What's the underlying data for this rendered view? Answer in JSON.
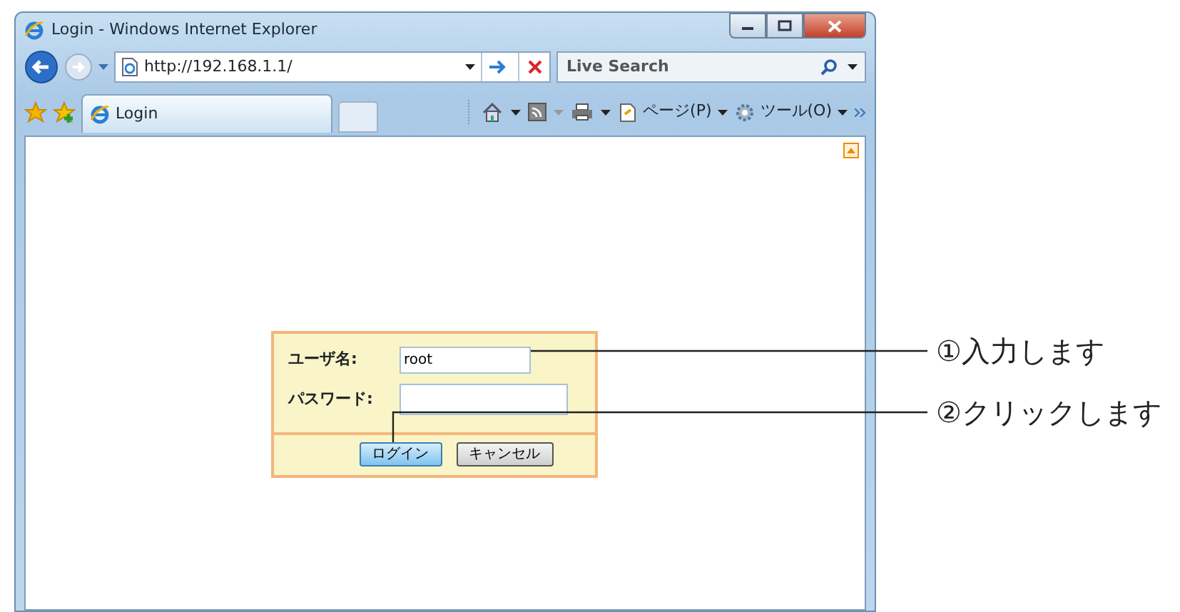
{
  "window": {
    "title": "Login - Windows Internet Explorer"
  },
  "address_bar": {
    "url": "http://192.168.1.1/"
  },
  "search": {
    "placeholder": "Live Search"
  },
  "tabs": [
    {
      "label": "Login",
      "selected": true
    }
  ],
  "toolbar": [
    {
      "label": "ページ(P)"
    },
    {
      "label": "ツール(O)"
    }
  ],
  "form": {
    "fields": [
      {
        "label": "ユーザ名:",
        "value": "root"
      },
      {
        "label": "パスワード:"
      }
    ],
    "buttons": [
      {
        "label": "ログイン",
        "kind": "primary"
      },
      {
        "label": "キャンセル",
        "kind": "secondary"
      }
    ]
  },
  "callouts": [
    {
      "text": "①入力します"
    },
    {
      "text": "②クリックします"
    }
  ]
}
